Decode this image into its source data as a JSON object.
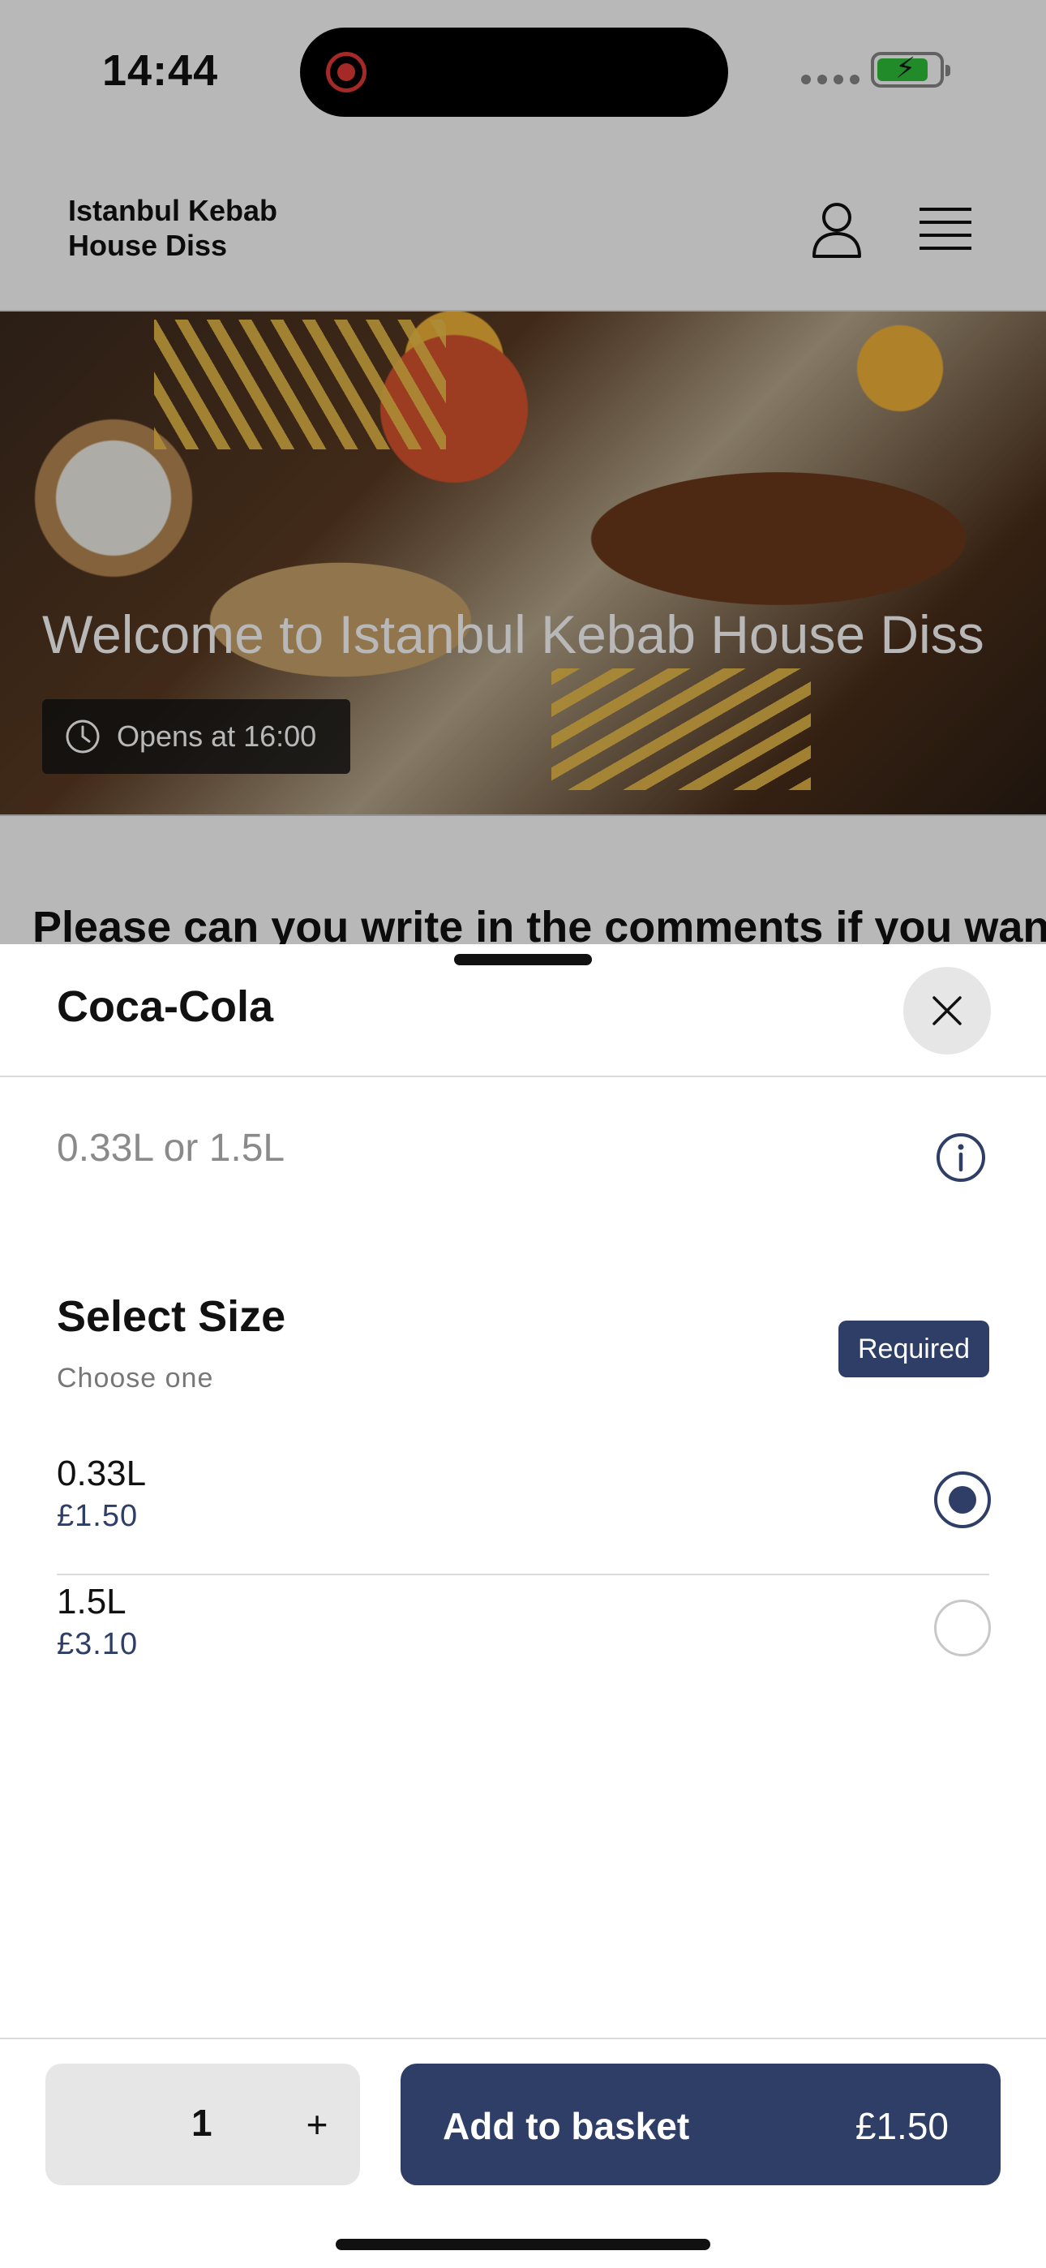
{
  "status_bar": {
    "time": "14:44"
  },
  "header": {
    "brand": "Istanbul Kebab House Diss"
  },
  "hero": {
    "title": "Welcome to Istanbul Kebab House Diss",
    "opens": "Opens at 16:00"
  },
  "banner": {
    "text": "Please can you write in the comments if you want"
  },
  "sheet": {
    "title": "Coca-Cola",
    "description": "0.33L or 1.5L",
    "section": {
      "title": "Select Size",
      "subtitle": "Choose one",
      "required_label": "Required",
      "options": [
        {
          "name": "0.33L",
          "price": "£1.50",
          "selected": true
        },
        {
          "name": "1.5L",
          "price": "£3.10",
          "selected": false
        }
      ]
    },
    "footer": {
      "quantity": "1",
      "plus_label": "+",
      "add_label": "Add to basket",
      "add_price": "£1.50"
    }
  },
  "colors": {
    "accent": "#2f3e66",
    "battery": "#2fbf3a",
    "record": "#e53935"
  }
}
